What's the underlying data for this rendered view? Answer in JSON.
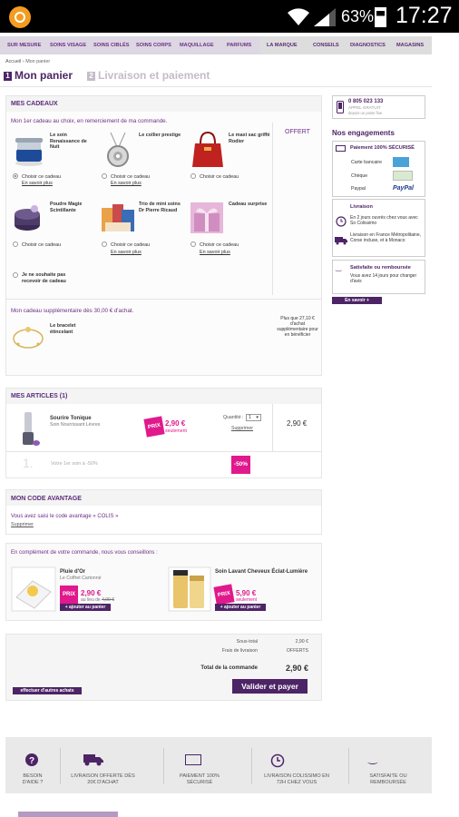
{
  "status": {
    "battery": "63%",
    "time": "17:27"
  },
  "nav": [
    "SUR MESURE",
    "SOINS VISAGE",
    "SOINS CIBLÉS",
    "SOINS CORPS",
    "MAQUILLAGE",
    "PARFUMS",
    "LA MARQUE",
    "CONSEILS",
    "DIAGNOSTICS",
    "MAGASINS"
  ],
  "breadcrumb": {
    "home": "Accueil",
    "sep": "›",
    "current": "Mon panier"
  },
  "steps": [
    {
      "num": "1",
      "label": "Mon panier"
    },
    {
      "num": "2",
      "label": "Livraison et paiement"
    }
  ],
  "gifts": {
    "title": "MES CADEAUX",
    "intro": "Mon 1er cadeau au choix, en remerciement de ma commande.",
    "offert": "OFFERT",
    "items": [
      {
        "name": "Le soin Renaissance de Nuit",
        "choose": "Choisir ce cadeau",
        "more": "En savoir plus"
      },
      {
        "name": "Le collier prestige",
        "choose": "Choisir ce cadeau",
        "more": "En savoir plus"
      },
      {
        "name": "Le maxi sac griffé Rodier",
        "choose": "Choisir ce cadeau",
        "more": ""
      },
      {
        "name": "Poudre Magie Scintillante",
        "choose": "Choisir ce cadeau",
        "more": ""
      },
      {
        "name": "Trio de mini soins Dr Pierre Ricaud",
        "choose": "Choisir ce cadeau",
        "more": "En savoir plus"
      },
      {
        "name": "Cadeau surprise",
        "choose": "Choisir ce cadeau",
        "more": "En savoir plus"
      }
    ],
    "none": "Je ne souhaite pas recevoir de cadeau",
    "extra_intro": "Mon cadeau supplémentaire dès 30,00 € d'achat.",
    "extra_name": "Le bracelet étincelant",
    "extra_note": "Plus que 27,10 € d'achat supplémentaire pour en bénéficier"
  },
  "articles": {
    "title": "MES ARTICLES (1)",
    "product": "Sourire Tonique",
    "subtitle": "Soin Nourrissant Lèvres",
    "badge": "PRIX",
    "price": "2,90 €",
    "price_note": "seulement",
    "qty_label": "Quantité :",
    "qty": "1",
    "remove": "Supprimer",
    "total": "2,90 €",
    "promo_num": "1.",
    "promo_text": "Votre 1er soin à -50%",
    "promo_badge": "-50%"
  },
  "code": {
    "title": "MON CODE AVANTAGE",
    "text": "Vous avez saisi le code avantage « COLIS »",
    "remove": "Supprimer"
  },
  "reco": {
    "intro": "En complément de votre commande, nous vous conseillons :",
    "items": [
      {
        "name": "Pluie d'Or",
        "sub": "Le Coffret Cartonné",
        "badge": "PRIX",
        "price": "2,90 €",
        "old_prefix": "au lieu de",
        "old": "4,90 €",
        "add": "+ ajouter au panier"
      },
      {
        "name": "Soin Lavant Cheveux Éclat-Lumière",
        "sub": "",
        "badge": "PRIX",
        "price": "5,90 €",
        "old_prefix": "seulement",
        "old": "",
        "add": "+ ajouter au panier"
      }
    ]
  },
  "summary": {
    "subtotal_label": "Sous-total",
    "subtotal": "2,90 €",
    "shipping_label": "Frais de livraison",
    "shipping": "OFFERTS",
    "total_label": "Total de la commande",
    "total": "2,90 €",
    "validate": "Valider et payer",
    "continue": "effectuer d'autres achats"
  },
  "side": {
    "phone": "0 805 023 133",
    "phone_note1": "APPEL GRATUIT",
    "phone_note2": "depuis un poste fixe",
    "engagements": "Nos engagements",
    "payment_title": "Paiement 100% SÉCURISÉ",
    "pay_methods": [
      "Carte bancaire",
      "Chèque",
      "Paypal"
    ],
    "paypal": "PayPal",
    "delivery_title": "Livraison",
    "delivery1": "En 2 jours ouvrés chez vous avec So Colissimo",
    "delivery2": "Livraison en France Métropolitaine, Corse incluse, et à Monaco",
    "satisfied_title": "Satisfaite ou remboursée",
    "satisfied_text": "Vous avez 14 jours pour changer d'avis",
    "more": "En savoir +"
  },
  "footer": [
    {
      "icon": "help-icon",
      "text": "BESOIN D'AIDE ?"
    },
    {
      "icon": "truck-icon",
      "text": "LIVRAISON OFFERTE DÈS 20€ D'ACHAT"
    },
    {
      "icon": "card-icon",
      "text": "PAIEMENT 100% SÉCURISÉ"
    },
    {
      "icon": "clock-icon",
      "text": "LIVRAISON COLISSIMO EN 72H CHEZ VOUS"
    },
    {
      "icon": "smile-icon",
      "text": "SATISFAITE OU REMBOURSÉE"
    }
  ]
}
